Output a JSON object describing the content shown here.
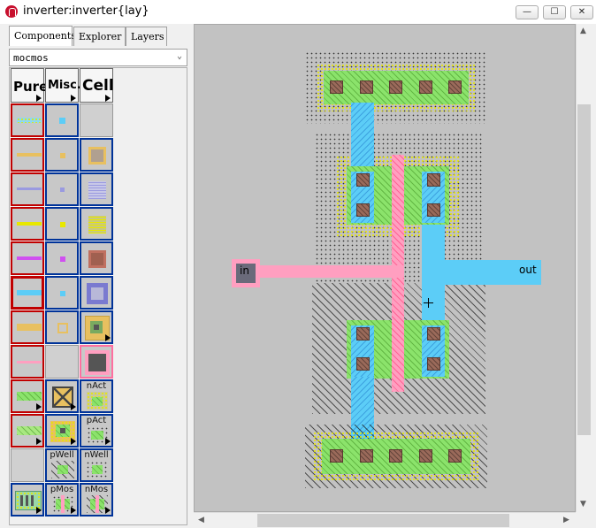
{
  "window": {
    "title": "inverter:inverter{lay}",
    "minimize": "—",
    "maximize": "☐",
    "close": "✕"
  },
  "tabs": [
    {
      "label": "Components"
    },
    {
      "label": "Explorer"
    },
    {
      "label": "Layers"
    }
  ],
  "technology": {
    "selected": "mocmos"
  },
  "palette": {
    "headers": [
      {
        "label": "Pure"
      },
      {
        "label": "Misc."
      },
      {
        "label": "Cell"
      }
    ],
    "cell_labels": {
      "nact": "nAct",
      "pact": "pAct",
      "pwell": "pWell",
      "nwell": "nWell",
      "pmos": "pMos",
      "nmos": "nMos"
    }
  },
  "layout": {
    "exports": {
      "input": "in",
      "output": "out"
    }
  },
  "colors": {
    "poly": "#ff9fc0",
    "metal1": "#5ccdf7",
    "active": "#8be36b",
    "select": "#e8e800",
    "contact": "#9a6a5a"
  }
}
